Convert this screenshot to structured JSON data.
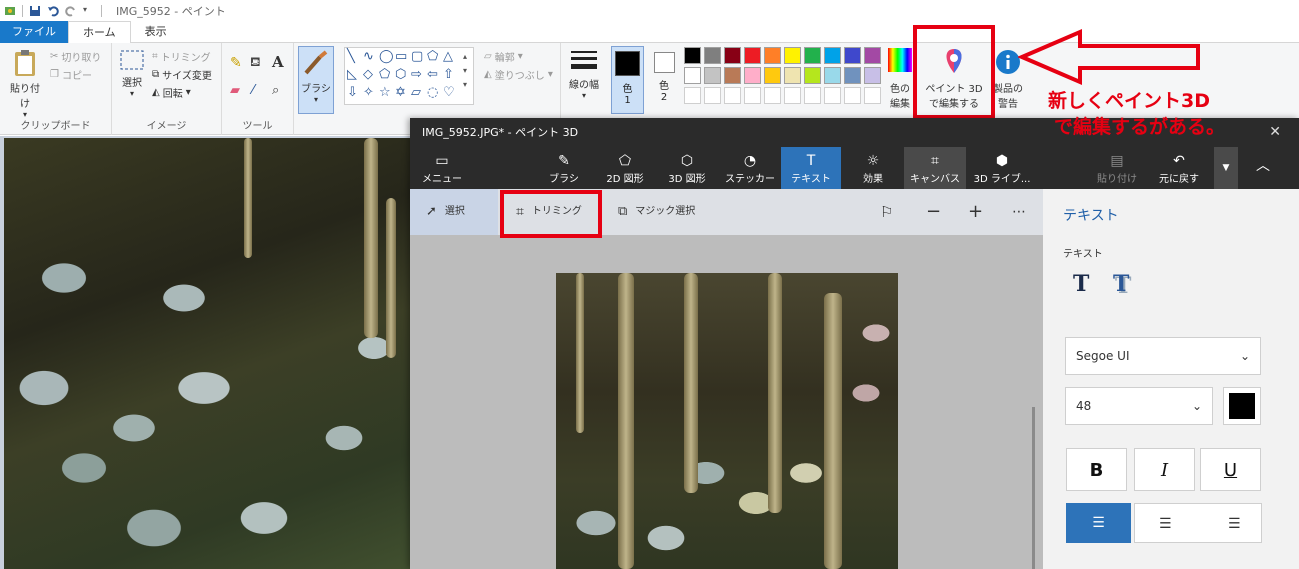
{
  "qat": {
    "title": "IMG_5952 - ペイント"
  },
  "tabs": [
    "ファイル",
    "ホーム",
    "表示"
  ],
  "ribbon": {
    "clipboard": {
      "paste": "貼り付け",
      "cut": "切り取り",
      "copy": "コピー",
      "label": "クリップボード"
    },
    "image": {
      "select": "選択",
      "crop": "トリミング",
      "resize": "サイズ変更",
      "rotate": "回転",
      "label": "イメージ"
    },
    "tools": {
      "label": "ツール"
    },
    "brush": "ブラシ",
    "shapes": {
      "outline": "輪郭",
      "fill": "塗りつぶし"
    },
    "size": "線の幅",
    "color1": {
      "label": "色",
      "num": "1"
    },
    "color2": {
      "label": "色",
      "num": "2"
    },
    "edit_colors": [
      "色の",
      "編集"
    ],
    "paint3d": [
      "ペイント 3D",
      "で編集する"
    ],
    "product_alert": [
      "製品の",
      "警告"
    ],
    "palette": [
      "#000000",
      "#7f7f7f",
      "#880015",
      "#ed1c24",
      "#ff7f27",
      "#fff200",
      "#22b14c",
      "#00a2e8",
      "#3f48cc",
      "#a349a4",
      "#ffffff",
      "#c3c3c3",
      "#b97a57",
      "#ffaec9",
      "#ffc90e",
      "#efe4b0",
      "#b5e61d",
      "#99d9ea",
      "#7092be",
      "#c8bfe7"
    ]
  },
  "p3d": {
    "title": "IMG_5952.JPG* - ペイント 3D",
    "close": "✕",
    "menu": "メニュー",
    "tools": [
      "ブラシ",
      "2D 図形",
      "3D 図形",
      "ステッカー",
      "テキスト",
      "効果",
      "キャンバス",
      "3D ライブ..."
    ],
    "paste": "貼り付け",
    "undo": "元に戻す",
    "sub": {
      "select": "選択",
      "crop": "トリミング",
      "magic": "マジック選択"
    },
    "panel": {
      "title": "テキスト",
      "sub": "テキスト",
      "font": "Segoe UI",
      "size": "48",
      "bold": "B",
      "italic": "I",
      "underline": "U"
    }
  },
  "annotation": [
    "新しくペイント3D",
    "で編集するがある。"
  ]
}
